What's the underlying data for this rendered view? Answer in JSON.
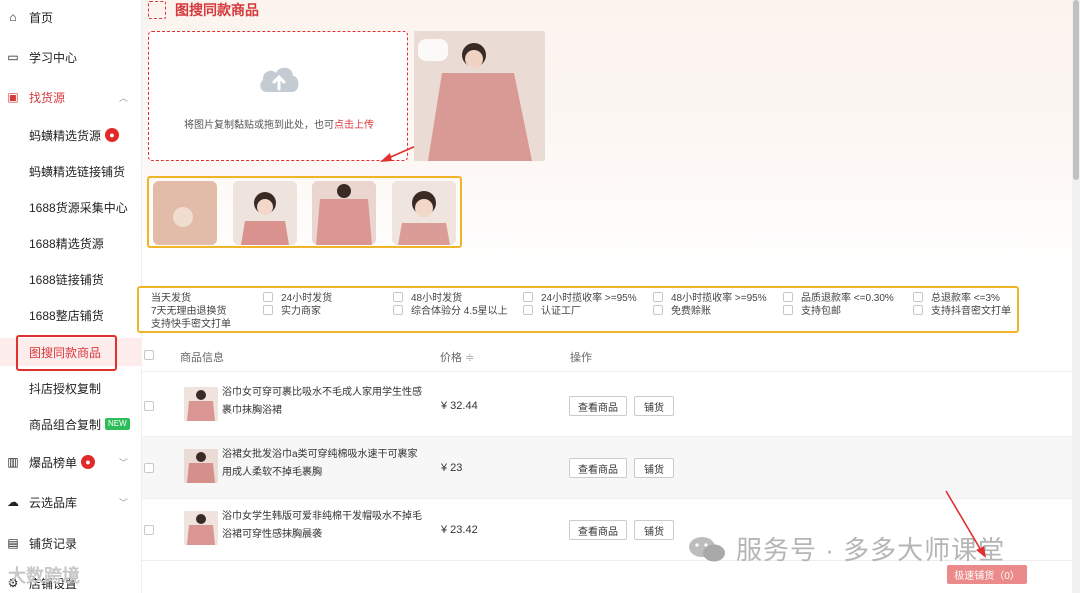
{
  "sidebar": {
    "items": [
      {
        "label": "首页",
        "icon": "home-icon"
      },
      {
        "label": "学习中心",
        "icon": "book-icon"
      },
      {
        "label": "找货源",
        "icon": "box-icon"
      },
      {
        "label": "爆品榜单",
        "icon": "chart-icon"
      },
      {
        "label": "云选品库",
        "icon": "cloud-icon"
      },
      {
        "label": "铺货记录",
        "icon": "record-icon"
      },
      {
        "label": "店铺设置",
        "icon": "settings-icon"
      }
    ],
    "sub_items": [
      "蚂蟥精选货源",
      "蚂蟥精选链接铺货",
      "1688货源采集中心",
      "1688精选货源",
      "1688链接铺货",
      "1688整店铺货",
      "图搜同款商品",
      "抖店授权复制",
      "商品组合复制"
    ],
    "new_badge": "NEW"
  },
  "page": {
    "title": "图搜同款商品",
    "upload_text": "将图片复制黏贴或拖到此处，也可",
    "upload_link": "点击上传"
  },
  "filters": [
    "当天发货",
    "24小时发货",
    "48小时发货",
    "24小时揽收率 >=95%",
    "48小时揽收率 >=95%",
    "品质退款率 <=0.30%",
    "总退款率 <=3%",
    "7天无理由退换货",
    "实力商家",
    "综合体验分 4.5星以上",
    "认证工厂",
    "免费赊账",
    "支持包邮",
    "支持抖音密文打单",
    "支持快手密文打单"
  ],
  "table": {
    "headers": {
      "info": "商品信息",
      "price": "价格",
      "sort_icon": "≑",
      "action": "操作"
    },
    "rows": [
      {
        "name": "浴巾女可穿可裹比吸水不毛成人家用学生性感裹巾抹胸浴裙",
        "price": "¥ 32.44"
      },
      {
        "name": "浴裙女批发浴巾a类可穿纯棉吸水速干可裹家用成人柔软不掉毛裹胸",
        "price": "¥ 23"
      },
      {
        "name": "浴巾女学生韩版可爱非纯棉干发帽吸水不掉毛浴裙可穿性感抹胸晨袭",
        "price": "¥ 23.42"
      }
    ],
    "view_label": "查看商品",
    "list_label": "铺货"
  },
  "bulk_button": "极速铺货（0）",
  "watermark": "服务号 · 多多大师课堂",
  "watermark2": "大数跨境",
  "colors": {
    "accent": "#d6393c",
    "highlight": "#f0b429"
  }
}
